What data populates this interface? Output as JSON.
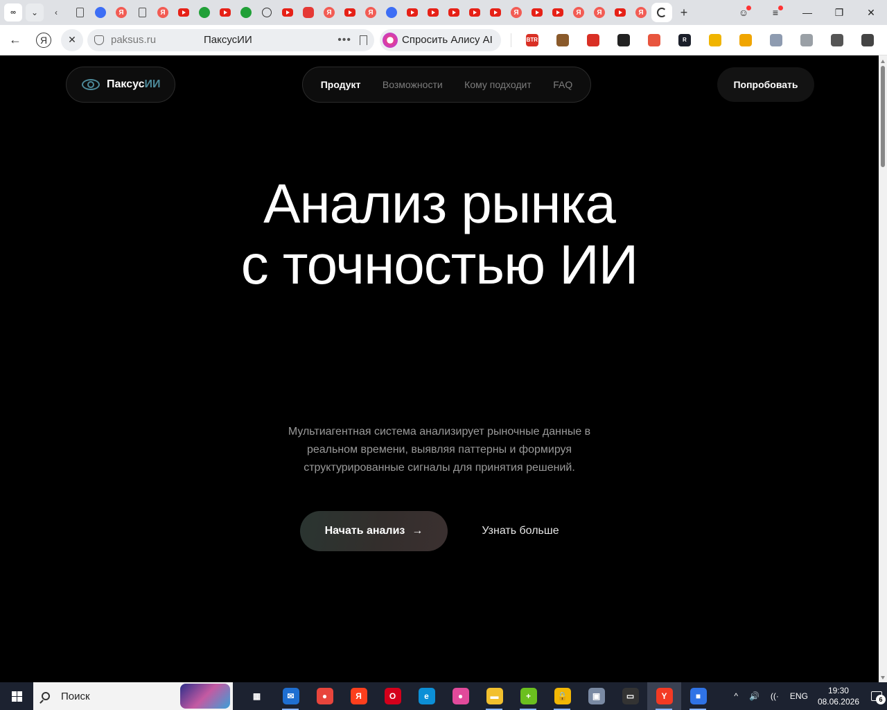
{
  "browser": {
    "tab_menu_glyph": "∞",
    "tabs": [
      {
        "icon": "document-icon"
      },
      {
        "icon": "bird-icon"
      },
      {
        "icon": "yandex-icon"
      },
      {
        "icon": "document-icon"
      },
      {
        "icon": "yandex-icon"
      },
      {
        "icon": "youtube-icon"
      },
      {
        "icon": "sber-icon"
      },
      {
        "icon": "youtube-icon"
      },
      {
        "icon": "sber-icon"
      },
      {
        "icon": "alice-outline-icon"
      },
      {
        "icon": "youtube-icon"
      },
      {
        "icon": "red-app-icon"
      },
      {
        "icon": "yandex-icon"
      },
      {
        "icon": "youtube-icon"
      },
      {
        "icon": "yandex-icon"
      },
      {
        "icon": "blue-app-icon"
      },
      {
        "icon": "youtube-icon"
      },
      {
        "icon": "youtube-icon"
      },
      {
        "icon": "youtube-icon"
      },
      {
        "icon": "youtube-icon"
      },
      {
        "icon": "youtube-icon"
      },
      {
        "icon": "yandex-icon"
      },
      {
        "icon": "youtube-icon"
      },
      {
        "icon": "youtube-icon"
      },
      {
        "icon": "yandex-icon"
      },
      {
        "icon": "yandex-icon"
      },
      {
        "icon": "youtube-icon"
      },
      {
        "icon": "yandex-icon"
      }
    ],
    "new_tab_glyph": "+",
    "address": {
      "domain": "paksus.ru",
      "page_title": "ПаксусИИ",
      "more_glyph": "•••"
    },
    "alice_button": "Спросить Алису AI",
    "extensions": [
      {
        "label": "BTR",
        "color": "#d93025"
      },
      {
        "label": "",
        "color": "#8a5a2b"
      },
      {
        "label": "",
        "color": "#d93025"
      },
      {
        "label": "",
        "color": "#222222"
      },
      {
        "label": "",
        "color": "#e8553e"
      },
      {
        "label": "R",
        "color": "#1b1f2a"
      },
      {
        "label": "",
        "color": "#f0b400"
      },
      {
        "label": "",
        "color": "#f0a500"
      },
      {
        "label": "",
        "color": "#8e9bb0"
      },
      {
        "label": "",
        "color": "#9aa0a6"
      },
      {
        "label": "",
        "color": "#555555"
      },
      {
        "label": "",
        "color": "#444444"
      }
    ]
  },
  "site": {
    "logo": {
      "brand": "Паксус",
      "brand_accent": "ИИ"
    },
    "nav": [
      {
        "label": "Продукт",
        "active": true
      },
      {
        "label": "Возможности",
        "active": false
      },
      {
        "label": "Кому подходит",
        "active": false
      },
      {
        "label": "FAQ",
        "active": false
      }
    ],
    "try_button": "Попробовать",
    "hero": {
      "title_line1": "Анализ рынка",
      "title_line2": "с точностью ИИ",
      "subtitle": "Мультиагентная система анализирует рыночные данные в реальном времени, выявляя паттерны и формируя структурированные сигналы для принятия решений.",
      "cta_primary": "Начать анализ",
      "cta_primary_arrow": "→",
      "cta_secondary": "Узнать больше"
    }
  },
  "taskbar": {
    "search_placeholder": "Поиск",
    "apps": [
      {
        "name": "task-view",
        "color": "#1c2230",
        "label": "▦"
      },
      {
        "name": "mail",
        "color": "#1f6fd1",
        "label": "✉"
      },
      {
        "name": "chrome",
        "color": "#e8453c",
        "label": "●"
      },
      {
        "name": "yandex",
        "color": "#fc3f1d",
        "label": "Я"
      },
      {
        "name": "opera",
        "color": "#d4001b",
        "label": "O"
      },
      {
        "name": "edge",
        "color": "#0c8fd6",
        "label": "e"
      },
      {
        "name": "chrome-alt",
        "color": "#e24a9b",
        "label": "●"
      },
      {
        "name": "file-explorer",
        "color": "#f2c02e",
        "label": "▬"
      },
      {
        "name": "green-app",
        "color": "#6bbf1f",
        "label": "+"
      },
      {
        "name": "lock-app",
        "color": "#f2b705",
        "label": "🔒"
      },
      {
        "name": "monitor-app",
        "color": "#7a8aa3",
        "label": "▣"
      },
      {
        "name": "terminal-app",
        "color": "#333333",
        "label": "▭"
      },
      {
        "name": "yandex-browser",
        "color": "#f33a24",
        "label": "Y"
      },
      {
        "name": "blue-app",
        "color": "#2f73e6",
        "label": "■"
      }
    ],
    "tray": {
      "chevron": "^",
      "volume": "🔊",
      "wifi": "((·",
      "language": "ENG",
      "time": "19:30",
      "date": "08.06.2026",
      "notifications": "6"
    }
  }
}
